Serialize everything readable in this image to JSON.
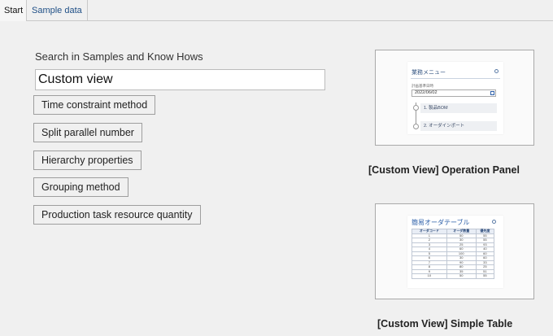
{
  "tabs": [
    {
      "label": "Start",
      "active": true
    },
    {
      "label": "Sample data",
      "active": false
    }
  ],
  "search": {
    "label": "Search in Samples and Know Hows",
    "value": "Custom view"
  },
  "sample_buttons": [
    {
      "label": "Time constraint method"
    },
    {
      "label": "Split parallel number"
    },
    {
      "label": "Hierarchy properties"
    },
    {
      "label": "Grouping method"
    },
    {
      "label": "Production task resource quantity"
    }
  ],
  "cards": [
    {
      "caption": "[Custom View] Operation Panel",
      "preview": {
        "title": "業務メニュー",
        "date_label": "計画基準日時",
        "date_value": "2022/06/02",
        "steps": [
          "1. 製品BOM",
          "2. オーダインポート"
        ]
      }
    },
    {
      "caption": "[Custom View] Simple Table",
      "preview": {
        "title": "簡易オーダテーブル",
        "columns": [
          "オーダコード",
          "オーダ数量",
          "優先度"
        ],
        "rows": [
          [
            "1",
            "50",
            "55"
          ],
          [
            "2",
            "30",
            "55"
          ],
          [
            "3",
            "25",
            "93"
          ],
          [
            "4",
            "60",
            "40"
          ],
          [
            "5",
            "100",
            "60"
          ],
          [
            "6",
            "30",
            "60"
          ],
          [
            "7",
            "90",
            "33"
          ],
          [
            "8",
            "80",
            "25"
          ],
          [
            "9",
            "35",
            "51"
          ],
          [
            "10",
            "50",
            "55"
          ]
        ]
      }
    }
  ],
  "colors": {
    "background": "#f0f0f0",
    "tab_link": "#1f4f86",
    "accent": "#2b5ea8"
  }
}
